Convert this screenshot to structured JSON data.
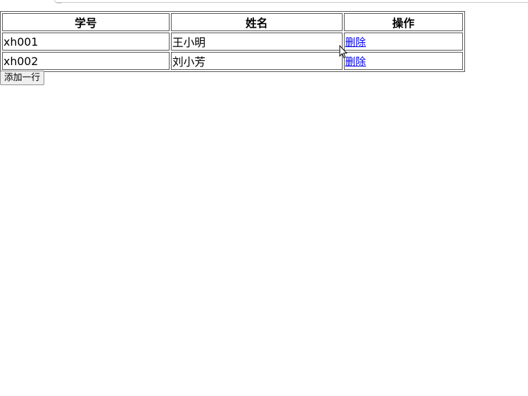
{
  "table": {
    "headers": [
      "学号",
      "姓名",
      "操作"
    ],
    "rows": [
      {
        "id": "xh001",
        "name": "王小明",
        "action": "删除"
      },
      {
        "id": "xh002",
        "name": "刘小芳",
        "action": "删除"
      }
    ]
  },
  "controls": {
    "add_row_label": "添加一行"
  },
  "colors": {
    "link": "#0000ee",
    "border": "#555555",
    "button_bg": "#efefef"
  },
  "icons": {
    "cursor": "mouse-pointer-icon"
  }
}
